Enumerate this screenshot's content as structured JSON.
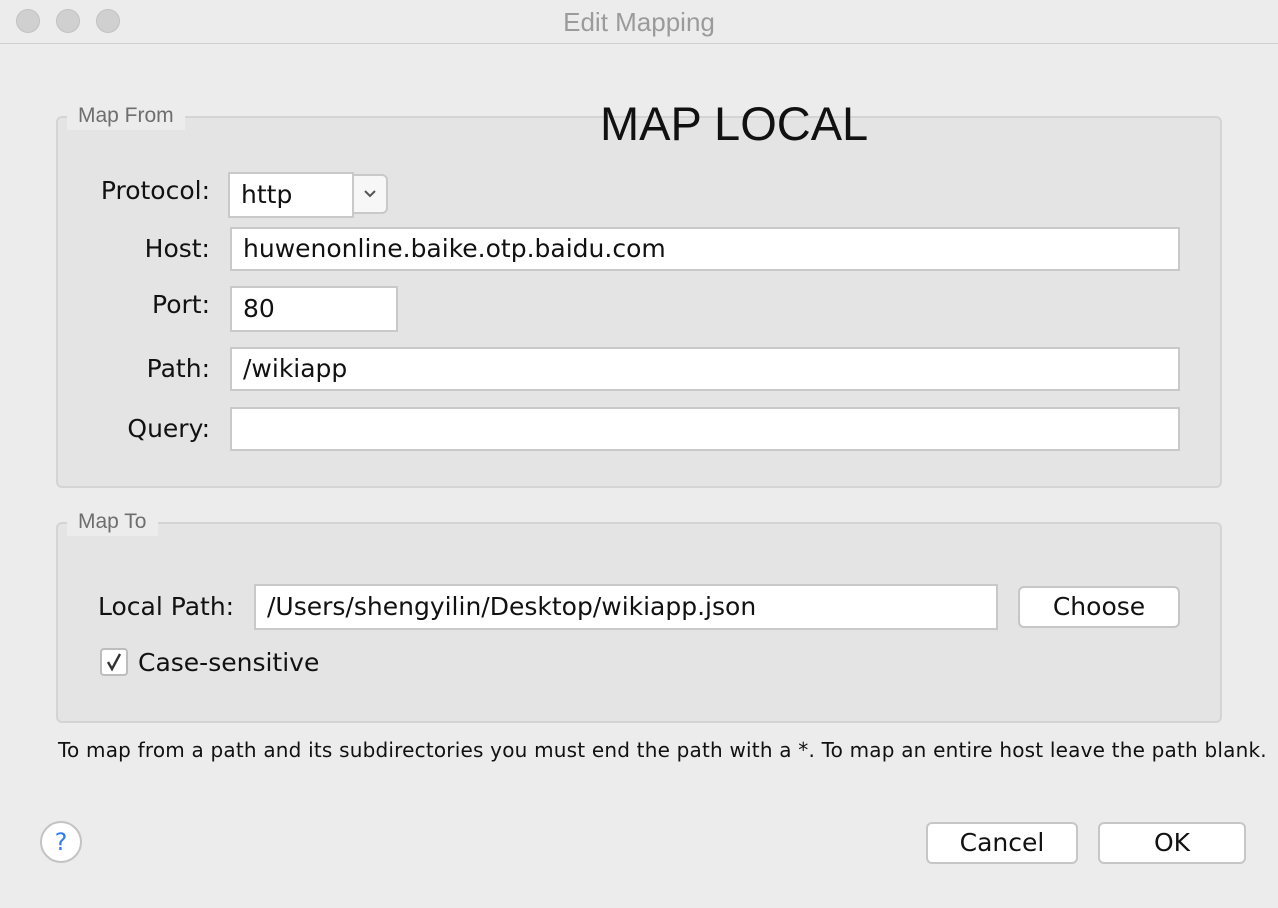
{
  "window": {
    "title": "Edit Mapping"
  },
  "overlay_title": "MAP LOCAL",
  "map_from": {
    "legend": "Map From",
    "protocol": {
      "label": "Protocol:",
      "value": "http"
    },
    "host": {
      "label": "Host:",
      "value": "huwenonline.baike.otp.baidu.com"
    },
    "port": {
      "label": "Port:",
      "value": "80"
    },
    "path": {
      "label": "Path:",
      "value": "/wikiapp"
    },
    "query": {
      "label": "Query:",
      "value": ""
    }
  },
  "map_to": {
    "legend": "Map To",
    "local_path": {
      "label": "Local Path:",
      "value": "/Users/shengyilin/Desktop/wikiapp.json"
    },
    "choose_label": "Choose",
    "case_sensitive": {
      "label": "Case-sensitive",
      "checked": true,
      "check_glyph": "✓"
    }
  },
  "note": "To map from a path and its subdirectories you must end the path with a *. To map an entire host leave the path blank.",
  "footer": {
    "help_glyph": "?",
    "cancel_label": "Cancel",
    "ok_label": "OK"
  },
  "icons": {
    "dropdown": "chevron-down-icon",
    "help": "help-icon",
    "check": "checkmark-icon"
  }
}
